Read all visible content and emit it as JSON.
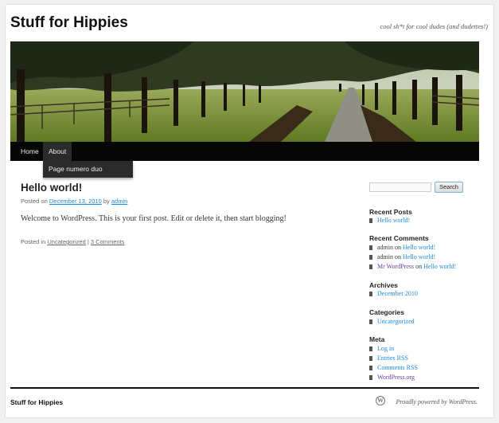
{
  "site": {
    "title": "Stuff for Hippies",
    "description": "cool sh*t for cool dudes (and dudettes!)"
  },
  "nav": {
    "home": "Home",
    "about": "About",
    "dropdown_item": "Page numero duo"
  },
  "post": {
    "title": "Hello world!",
    "meta_prefix": "Posted on",
    "date": "December 13, 2010",
    "meta_by": "by",
    "author": "admin",
    "body": "Welcome to WordPress. This is your first post. Edit or delete it, then start blogging!",
    "footer_prefix": "Posted in",
    "category": "Uncategorized",
    "separator": "|",
    "comments": "3 Comments"
  },
  "sidebar": {
    "search_button": "Search",
    "recent_posts": {
      "title": "Recent Posts",
      "items": [
        "Hello world!"
      ]
    },
    "recent_comments": {
      "title": "Recent Comments",
      "items": [
        {
          "author": "admin",
          "on": "on",
          "post": "Hello world!"
        },
        {
          "author": "admin",
          "on": "on",
          "post": "Hello world!"
        },
        {
          "author": "Mr WordPress",
          "on": "on",
          "post": "Hello world!"
        }
      ]
    },
    "archives": {
      "title": "Archives",
      "items": [
        "December 2010"
      ]
    },
    "categories": {
      "title": "Categories",
      "items": [
        "Uncategorized"
      ]
    },
    "meta": {
      "title": "Meta",
      "items": [
        "Log in",
        "Entries RSS",
        "Comments RSS",
        "WordPress.org"
      ]
    }
  },
  "footer": {
    "title": "Stuff for Hippies",
    "credit": "Proudly powered by WordPress."
  },
  "colors": {
    "link": "#1b8be0",
    "visited_link": "#6a3e9c",
    "nav_bg": "#060606",
    "nav_active": "#2b2b2b"
  },
  "icons": {
    "wordpress": "wordpress-logo-icon",
    "bullet": "square-bullet-icon"
  }
}
